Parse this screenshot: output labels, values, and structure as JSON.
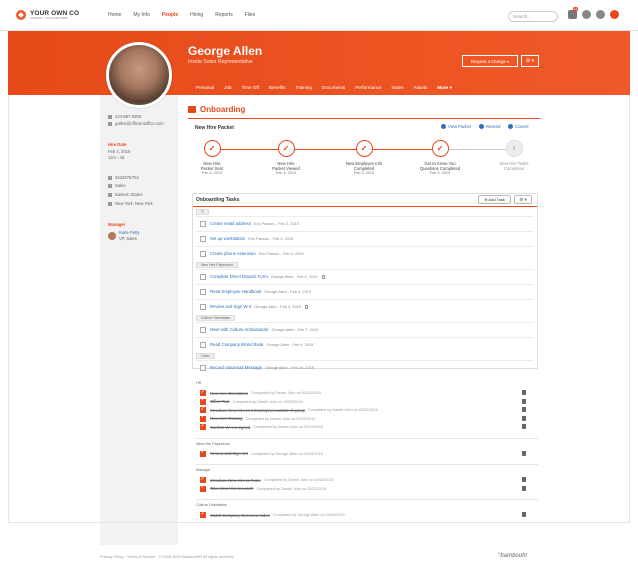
{
  "app": {
    "logo_name": "YOUR OWN CO",
    "logo_tag": "COMPANY · LOGO GOES HERE"
  },
  "nav": {
    "links": [
      "Home",
      "My Info",
      "People",
      "Hiring",
      "Reports",
      "Files"
    ],
    "active": "People",
    "search_placeholder": "Search...",
    "notification_count": "12"
  },
  "employee": {
    "name": "George Allen",
    "title": "Inside Sales Representative",
    "request_change": "Request a Change ▾",
    "settings": "⚙ ▾",
    "tabs": [
      "Personal",
      "Job",
      "Time Off",
      "Benefits",
      "Training",
      "Documents",
      "Performance",
      "Notes",
      "Assets",
      "More ▾"
    ]
  },
  "sidebar": {
    "phone": "224-867-5309",
    "email": "gallen@efficientoffice.com",
    "hire_label": "Hire Date",
    "hire_date": "Feb 4, 2019",
    "tenure": "11m - 4d",
    "employee_id": "343487E754",
    "department": "Sales",
    "division": "Eastern States",
    "location": "New York, New York",
    "manager_label": "Manager",
    "manager_name": "Karle Petty",
    "manager_title": "VP, Sales"
  },
  "onboarding": {
    "title": "Onboarding",
    "packet_label": "New Hire Packet",
    "actions": [
      "View Packet",
      "Resend",
      "Cancel"
    ],
    "steps": [
      {
        "label1": "New Hire",
        "label2": "Packet Sent",
        "date": "Feb 4, 2019",
        "status": "done"
      },
      {
        "label1": "New Hire",
        "label2": "Packet Viewed",
        "date": "Feb 4, 2019",
        "status": "done"
      },
      {
        "label1": "New Employee Info",
        "label2": "Completed",
        "date": "Feb 4, 2019",
        "status": "done"
      },
      {
        "label1": "Get to Know You",
        "label2": "Questions Completed",
        "date": "Feb 4, 2019",
        "status": "done"
      },
      {
        "label1": "New Hire Tasks",
        "label2": "Completed",
        "date": "",
        "status": "pending"
      }
    ]
  },
  "tasks": {
    "header": "Onboarding Tasks",
    "add_task": "⊕ Add Task",
    "panel_settings": "⚙ ▾",
    "groups": [
      {
        "chip": "IT",
        "items": [
          {
            "name": "Create email address",
            "meta": "Eric Paxson - Feb 3, 2019",
            "attach": false
          },
          {
            "name": "Set up workstation",
            "meta": "Eric Paxson - Feb 3, 2019",
            "attach": false
          },
          {
            "name": "Create phone extension",
            "meta": "Eric Paxson - Feb 3, 2019",
            "attach": false
          }
        ]
      },
      {
        "chip": "New Hire Paperwork",
        "items": [
          {
            "name": "Complete Direct Deposit Form",
            "meta": "George Allen - Feb 4, 2019",
            "attach": true
          },
          {
            "name": "Read Employee Handbook",
            "meta": "George Allen - Feb 4, 2019",
            "attach": false
          },
          {
            "name": "Review and Sign W-4",
            "meta": "George Allen - Feb 4, 2019",
            "attach": true
          }
        ]
      },
      {
        "chip": "Culture Orientation",
        "items": [
          {
            "name": "Meet with Culture Ambassador",
            "meta": "George Allen - Feb 7, 2019",
            "attach": false
          },
          {
            "name": "Read Company Brand Book",
            "meta": "George Allen - Feb 9, 2019",
            "attach": false
          }
        ]
      },
      {
        "chip": "Other",
        "items": [
          {
            "name": "Record Voicemail Message",
            "meta": "George Allen - Feb 10, 2019",
            "attach": false
          }
        ]
      }
    ]
  },
  "completed": [
    {
      "section": "HR",
      "items": [
        {
          "name": "New Hire Orientation",
          "meta": "Completed by Daniel John on 02/22/2019"
        },
        {
          "name": "Office Tour",
          "meta": "Completed by Daniel John on 02/22/2019"
        },
        {
          "name": "Introduce New Hire to 4 Employees outside of group",
          "meta": "Completed by Daniel John on 02/22/2019"
        },
        {
          "name": "New Hire Training",
          "meta": "Completed by Daniel John on 02/22/2019"
        },
        {
          "name": "Confirm W-4 is signed",
          "meta": "Completed by Daniel John on 02/22/2019"
        }
      ]
    },
    {
      "section": "New Hire Paperwork",
      "items": [
        {
          "name": "Review and Sign W4",
          "meta": "Completed by George Allen on 02/04/2019"
        }
      ]
    },
    {
      "section": "Manager",
      "items": [
        {
          "name": "Introduce New Hire to Team",
          "meta": "Completed by Daniel John on 02/22/2019"
        },
        {
          "name": "Take New Hire to Lunch",
          "meta": "Completed by Daniel John on 02/22/2019"
        }
      ]
    },
    {
      "section": "Culture Orientation",
      "items": [
        {
          "name": "Watch Company Overview Video",
          "meta": "Completed by George Allen on 02/04/2019"
        }
      ]
    }
  ],
  "footer": {
    "text": "Privacy Policy · Terms of Service · © 2008–2020 BambooHR All rights reserved.",
    "brand": "°bamboohr"
  },
  "colors": {
    "accent": "#e8481c",
    "link": "#2e6fb7"
  }
}
